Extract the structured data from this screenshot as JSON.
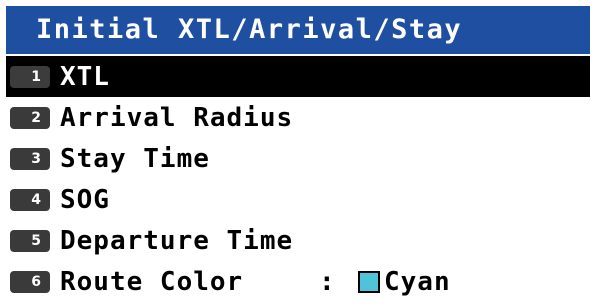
{
  "title": "Initial XTL/Arrival/Stay",
  "items": [
    {
      "key": "1",
      "label": "XTL",
      "selected": true
    },
    {
      "key": "2",
      "label": "Arrival Radius"
    },
    {
      "key": "3",
      "label": "Stay Time"
    },
    {
      "key": "4",
      "label": "SOG"
    },
    {
      "key": "5",
      "label": "Departure Time"
    },
    {
      "key": "6",
      "label": "Route Color",
      "separator": ":",
      "value": "Cyan",
      "swatch_color": "#4fc3d7"
    }
  ],
  "colors": {
    "title_bar": "#1f4fa0",
    "selected_row": "#000000",
    "key_badge": "#3a3a3a"
  }
}
